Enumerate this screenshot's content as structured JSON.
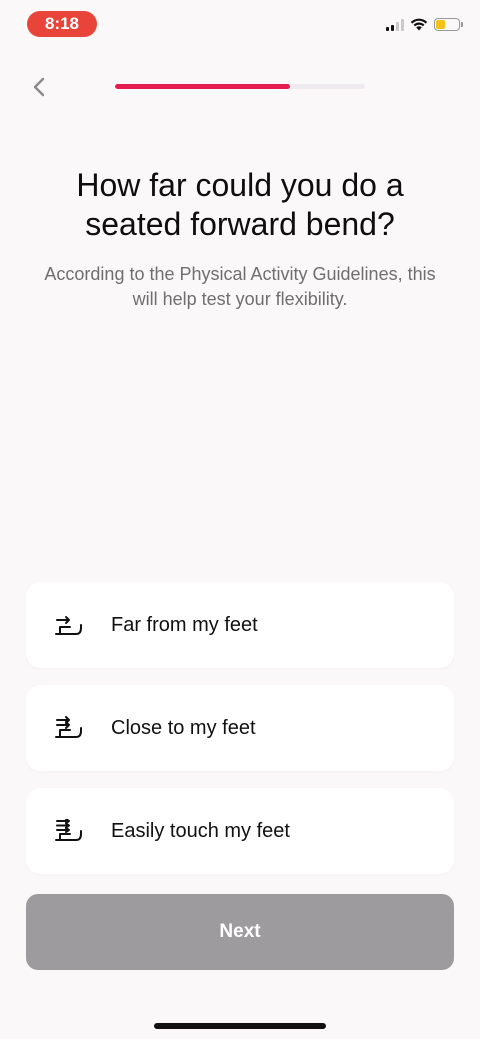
{
  "status_bar": {
    "time": "8:18"
  },
  "progress": {
    "fraction": 0.7
  },
  "header": {
    "title": "How far could you do a seated forward bend?",
    "subtitle": "According to the Physical Activity Guidelines, this will help test your flexibility."
  },
  "options": [
    {
      "label": "Far from my feet",
      "icon": "forward-bend-1-icon"
    },
    {
      "label": "Close to my feet",
      "icon": "forward-bend-2-icon"
    },
    {
      "label": "Easily touch my feet",
      "icon": "forward-bend-3-icon"
    }
  ],
  "next_button": {
    "label": "Next"
  },
  "colors": {
    "accent": "#e41c4f",
    "time_pill": "#e8443a",
    "disabled_button": "#9d9b9d",
    "background": "#fbf8fa"
  }
}
